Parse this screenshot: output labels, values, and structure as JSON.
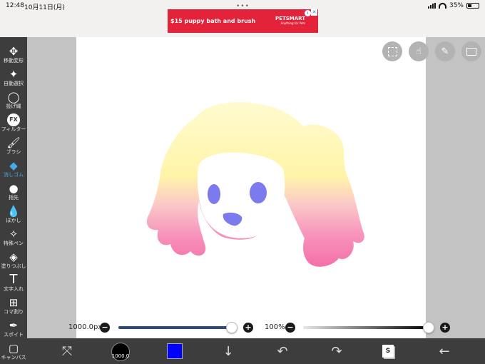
{
  "status": {
    "time": "12:48",
    "date": "10月11日(月)",
    "battery": "35%"
  },
  "ad": {
    "text": "$15 puppy bath and brush",
    "brand": "PETSMART",
    "tagline": "Anything for Pets",
    "info": "i",
    "close": "✕"
  },
  "tools": [
    {
      "label": "移動変形",
      "icon": "move-icon"
    },
    {
      "label": "自動選択",
      "icon": "magic-wand-icon"
    },
    {
      "label": "投げ縄",
      "icon": "lasso-icon"
    },
    {
      "label": "フィルター",
      "icon": "fx-icon"
    },
    {
      "label": "ブラシ",
      "icon": "brush-icon"
    },
    {
      "label": "消しゴム",
      "icon": "eraser-icon"
    },
    {
      "label": "指先",
      "icon": "smudge-icon"
    },
    {
      "label": "ぼかし",
      "icon": "blur-icon"
    },
    {
      "label": "特殊ペン",
      "icon": "special-pen-icon"
    },
    {
      "label": "塗りつぶし",
      "icon": "fill-icon"
    },
    {
      "label": "文字入れ",
      "icon": "text-icon"
    },
    {
      "label": "コマ割り",
      "icon": "frame-icon"
    },
    {
      "label": "スポイト",
      "icon": "eyedropper-icon"
    },
    {
      "label": "キャンバス",
      "icon": "canvas-icon"
    }
  ],
  "fx_text": "FX",
  "text_tool_glyph": "T",
  "active_tool": "消しゴム",
  "brush": {
    "size_label": "1000.0px",
    "size_value": "1000.0",
    "size_fraction": 1.0,
    "opacity_label": "100%",
    "opacity_fraction": 1.0,
    "minus": "−",
    "plus": "+"
  },
  "colors": {
    "current": "#0000ff",
    "toolbar": "#3d3d3d",
    "active_tool": "#4aa8e8",
    "hair_top": "#fff7b8",
    "hair_bottom": "#f77fb0",
    "face_marks": "#7b7bef"
  },
  "layer_button": "S"
}
